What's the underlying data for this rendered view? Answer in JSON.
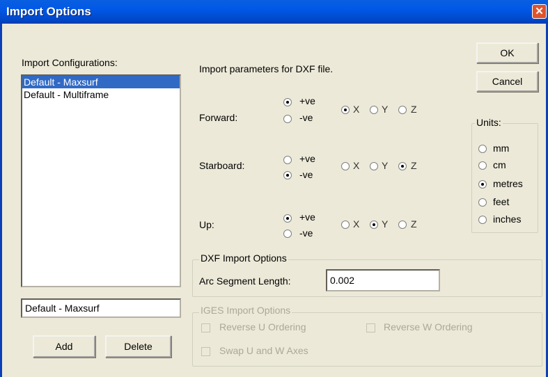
{
  "window": {
    "title": "Import Options"
  },
  "configs": {
    "label": "Import Configurations:",
    "items": [
      "Default - Maxsurf",
      "Default - Multiframe"
    ],
    "selected_index": 0,
    "name_value": "Default - Maxsurf",
    "add_label": "Add",
    "delete_label": "Delete"
  },
  "params": {
    "header": "Import parameters for DXF file.",
    "rows": [
      {
        "label": "Forward:",
        "sign": "+ve",
        "axis": "X"
      },
      {
        "label": "Starboard:",
        "sign": "-ve",
        "axis": "Z"
      },
      {
        "label": "Up:",
        "sign": "+ve",
        "axis": "Y"
      }
    ],
    "sign_options": [
      "+ve",
      "-ve"
    ],
    "axis_options": [
      "X",
      "Y",
      "Z"
    ]
  },
  "buttons": {
    "ok": "OK",
    "cancel": "Cancel"
  },
  "units": {
    "label": "Units:",
    "options": [
      "mm",
      "cm",
      "metres",
      "feet",
      "inches"
    ],
    "selected": "metres"
  },
  "dxf": {
    "legend": "DXF Import Options",
    "arc_label": "Arc Segment Length:",
    "arc_value": "0.002"
  },
  "iges": {
    "legend": "IGES Import Options",
    "reverse_u": "Reverse U Ordering",
    "reverse_w": "Reverse W Ordering",
    "swap_uw": "Swap U and W Axes",
    "checked": {
      "reverse_u": false,
      "reverse_w": false,
      "swap_uw": false
    }
  },
  "colors": {
    "titlebar": "#0058e6",
    "dialog_bg": "#ece9d8",
    "selection": "#316ac5",
    "close_button": "#e0532a",
    "disabled_text": "#aca899"
  }
}
